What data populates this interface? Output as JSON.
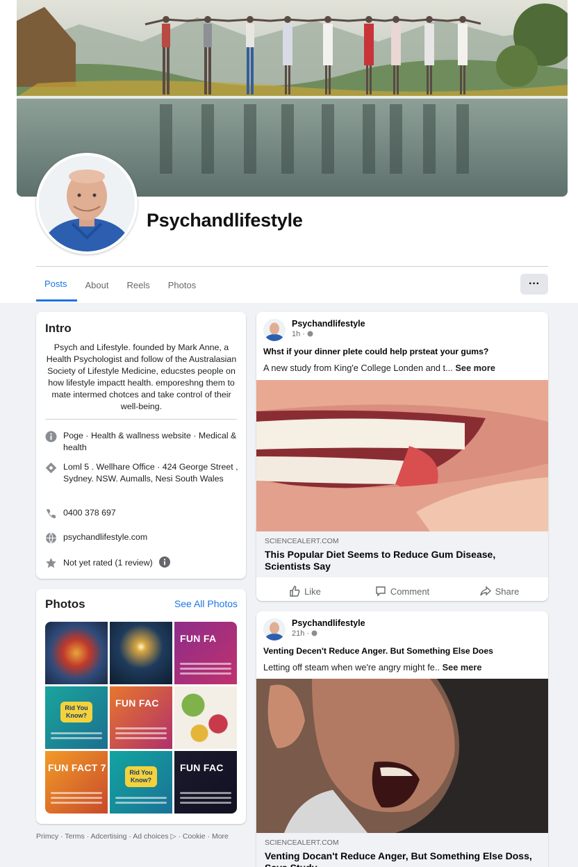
{
  "page": {
    "name": "Psychandlifestyle",
    "more_label": "···"
  },
  "tabs": [
    {
      "label": "Posts"
    },
    {
      "label": "About"
    },
    {
      "label": "Reels"
    },
    {
      "label": "Photos"
    }
  ],
  "intro": {
    "heading": "Intro",
    "bio": "Psych and Lifestyle. founded by Mark Anne, a Health Psychologist and follow of the Australasian Society of Lifestyle Medicine, educstes people on how lifestyle impactt health. emporeshng them to mate intermed chotces and take control of their well-being.",
    "category": "Poge · Health & wallness website · Medical & health",
    "address": "Loml 5 . Wellhare Office · 424 George Street , Sydney. NSW. Aumalls, Nesi South Wales",
    "phone": "0400 378 697",
    "website": "psychandlifestyle.com",
    "rating": "Not yet rated (1 review)"
  },
  "photos": {
    "heading": "Photos",
    "see_all": "See All Photos",
    "tiles": [
      {
        "label": ""
      },
      {
        "label": ""
      },
      {
        "label": "FUN FA"
      },
      {
        "label": "Rid You Know?"
      },
      {
        "label": "FUN FAC"
      },
      {
        "label": ""
      },
      {
        "label": "FUN FACT 7"
      },
      {
        "label": "Rid You Know?"
      },
      {
        "label": "FUN FAC"
      }
    ]
  },
  "footer": {
    "links": "Primcy · Terms · Adcertising · Ad choices ▷ · Cookie · More"
  },
  "posts": [
    {
      "author": "Psychandlifestyle",
      "time": "1h ·",
      "title": "Whst if your dinner plete could help prsteat your gums?",
      "text": "A new study from King'e College Londen and t...",
      "see_more": "See more",
      "link_domain": "SCIENCEALERT.COM",
      "link_title": "This Popular Diet Seems to Reduce Gum Disease, Scientists Say",
      "actions": {
        "like": "Like",
        "comment": "Comment",
        "share": "Share"
      }
    },
    {
      "author": "Psychandlifestyle",
      "time": "21h ·",
      "title": "Venting Decen't Reduce Anger. But Something Else Does",
      "text": "Letting off steam when we're angry might fe..",
      "see_more": "See mere",
      "link_domain": "SCIENCEALERT.COM",
      "link_title": "Venting Docan't Reduce Anger, But Something Else Doss, Says Study"
    }
  ],
  "icons": {
    "info": "info-icon",
    "location": "location-icon",
    "phone": "phone-icon",
    "globe": "globe-icon",
    "star": "star-icon"
  },
  "colors": {
    "accent": "#1b74e4",
    "background": "#f0f2f5"
  }
}
